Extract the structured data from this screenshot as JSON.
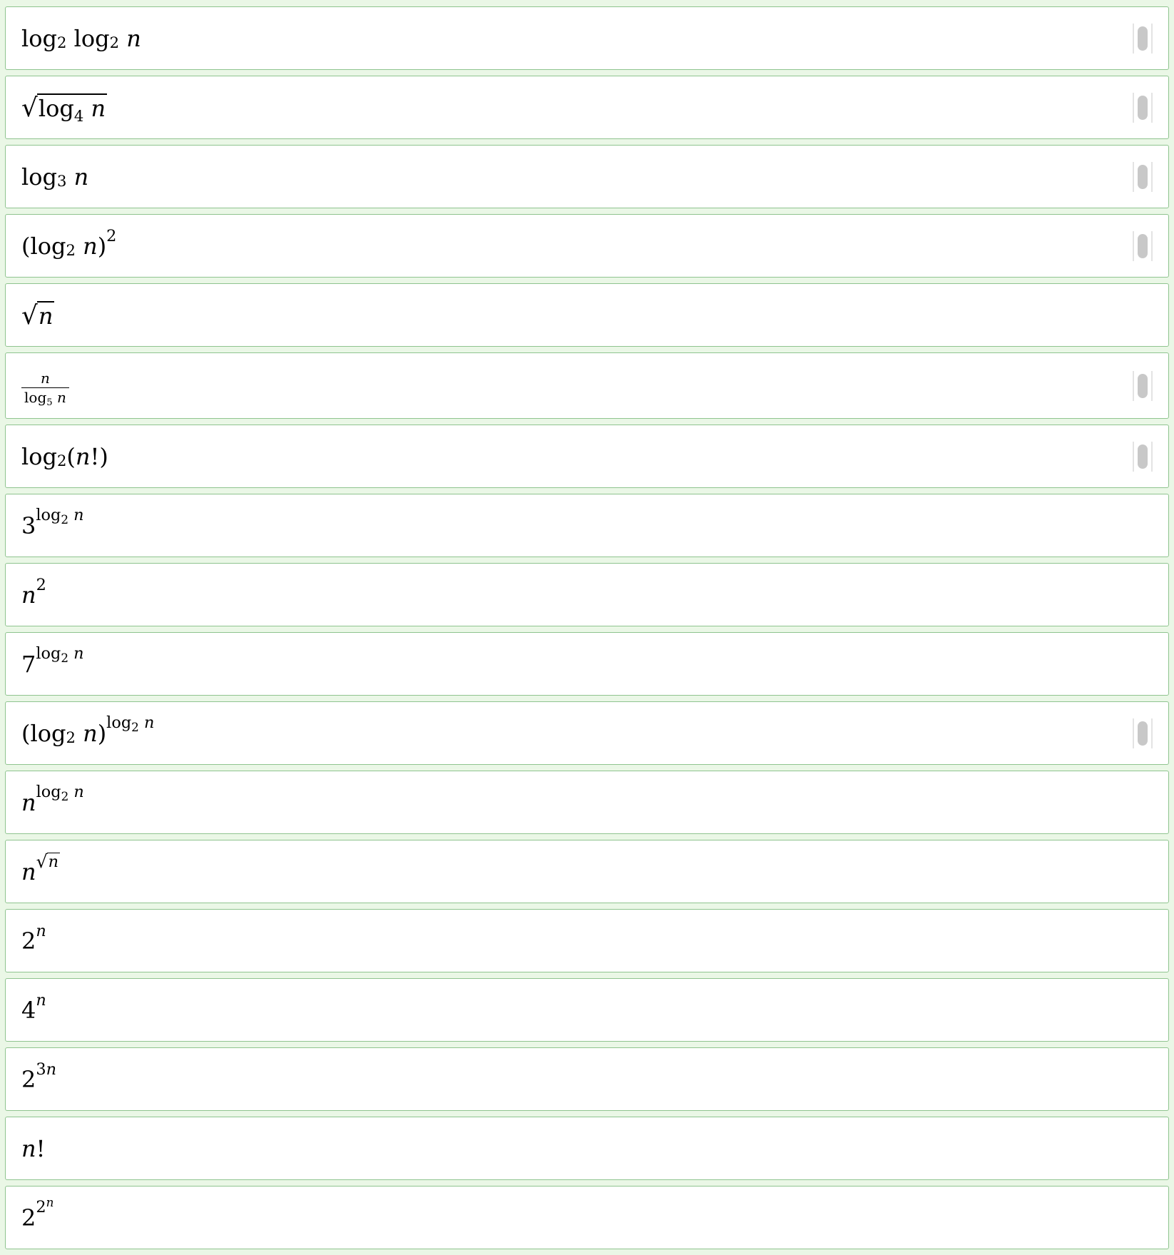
{
  "colors": {
    "page_background": "#eaf7e6",
    "card_background": "#ffffff",
    "card_border": "#8fc48f",
    "drag_handle": "#c8c8c8"
  },
  "items": [
    {
      "id": "log2-log2-n",
      "has_handle": true,
      "parts": {
        "log": "log",
        "base": "2",
        "n": "n"
      }
    },
    {
      "id": "sqrt-log4-n",
      "has_handle": true,
      "parts": {
        "radical": "√",
        "log": "log",
        "base": "4",
        "n": "n"
      }
    },
    {
      "id": "log3-n",
      "has_handle": true,
      "parts": {
        "log": "log",
        "base": "3",
        "n": "n"
      }
    },
    {
      "id": "log2-n-squared",
      "has_handle": true,
      "parts": {
        "open": "(",
        "close": ")",
        "log": "log",
        "base": "2",
        "n": "n",
        "exp": "2"
      }
    },
    {
      "id": "sqrt-n",
      "has_handle": false,
      "parts": {
        "radical": "√",
        "n": "n"
      }
    },
    {
      "id": "n-over-log5-n",
      "has_handle": true,
      "parts": {
        "n": "n",
        "log": "log",
        "base": "5"
      }
    },
    {
      "id": "log2-n-factorial",
      "has_handle": true,
      "parts": {
        "log": "log",
        "base": "2",
        "open": "(",
        "n": "n",
        "bang": "!",
        "close": ")"
      }
    },
    {
      "id": "3-pow-log2-n",
      "has_handle": false,
      "parts": {
        "coef": "3",
        "log": "log",
        "base": "2",
        "n": "n"
      }
    },
    {
      "id": "n-squared",
      "has_handle": false,
      "parts": {
        "n": "n",
        "exp": "2"
      }
    },
    {
      "id": "7-pow-log2-n",
      "has_handle": false,
      "parts": {
        "coef": "7",
        "log": "log",
        "base": "2",
        "n": "n"
      }
    },
    {
      "id": "log2-n-pow-log2-n",
      "has_handle": true,
      "parts": {
        "open": "(",
        "close": ")",
        "log": "log",
        "base": "2",
        "n": "n"
      }
    },
    {
      "id": "n-pow-log2-n",
      "has_handle": false,
      "parts": {
        "n": "n",
        "log": "log",
        "base": "2"
      }
    },
    {
      "id": "n-pow-sqrt-n",
      "has_handle": false,
      "parts": {
        "n": "n",
        "radical": "√"
      }
    },
    {
      "id": "2-pow-n",
      "has_handle": false,
      "parts": {
        "coef": "2",
        "n": "n"
      }
    },
    {
      "id": "4-pow-n",
      "has_handle": false,
      "parts": {
        "coef": "4",
        "n": "n"
      }
    },
    {
      "id": "2-pow-3n",
      "has_handle": false,
      "parts": {
        "coef": "2",
        "three": "3",
        "n": "n"
      }
    },
    {
      "id": "n-factorial",
      "has_handle": false,
      "parts": {
        "n": "n",
        "bang": "!"
      }
    },
    {
      "id": "2-pow-2-pow-n",
      "has_handle": false,
      "parts": {
        "coef": "2",
        "n": "n"
      }
    }
  ]
}
